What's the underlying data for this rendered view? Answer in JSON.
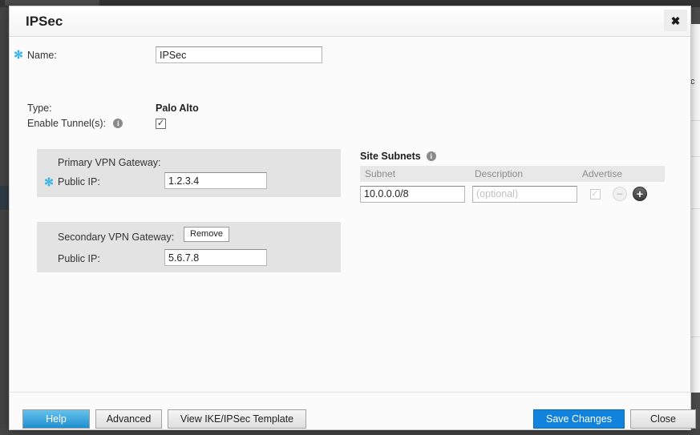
{
  "dialog": {
    "title": "IPSec",
    "close_icon": "close-icon",
    "close_glyph": "✖"
  },
  "form": {
    "name": {
      "required_marker": "✻",
      "label": "Name:",
      "value": "IPSec"
    },
    "type": {
      "label": "Type:",
      "value": "Palo Alto"
    },
    "enable_tunnels": {
      "label": "Enable Tunnel(s):",
      "info_icon": "info-icon",
      "info_glyph": "i",
      "checked": true,
      "check_glyph": "✓"
    }
  },
  "primary_gateway": {
    "title": "Primary VPN Gateway:",
    "required_marker": "✻",
    "public_ip_label": "Public IP:",
    "public_ip_value": "1.2.3.4"
  },
  "secondary_gateway": {
    "title": "Secondary VPN Gateway:",
    "remove_label": "Remove",
    "public_ip_label": "Public IP:",
    "public_ip_value": "5.6.7.8"
  },
  "site_subnets": {
    "title": "Site Subnets",
    "info_icon": "info-icon",
    "info_glyph": "i",
    "columns": [
      "Subnet",
      "Description",
      "Advertise"
    ],
    "rows": [
      {
        "subnet": "10.0.0.0/8",
        "description": "",
        "description_placeholder": "(optional)",
        "advertise": true,
        "advertise_glyph": "✓",
        "remove_glyph": "−",
        "add_glyph": "+"
      }
    ]
  },
  "footer": {
    "help_label": "Help",
    "advanced_label": "Advanced",
    "template_label": "View IKE/IPSec Template",
    "save_label": "Save Changes",
    "close_label": "Close"
  },
  "background": {
    "partial_text": "ac"
  },
  "colors": {
    "accent_blue": "#1183dd",
    "required_star": "#39b3e6",
    "panel_gray": "#e3e3e3",
    "table_header_gray": "#e8e8e8"
  }
}
